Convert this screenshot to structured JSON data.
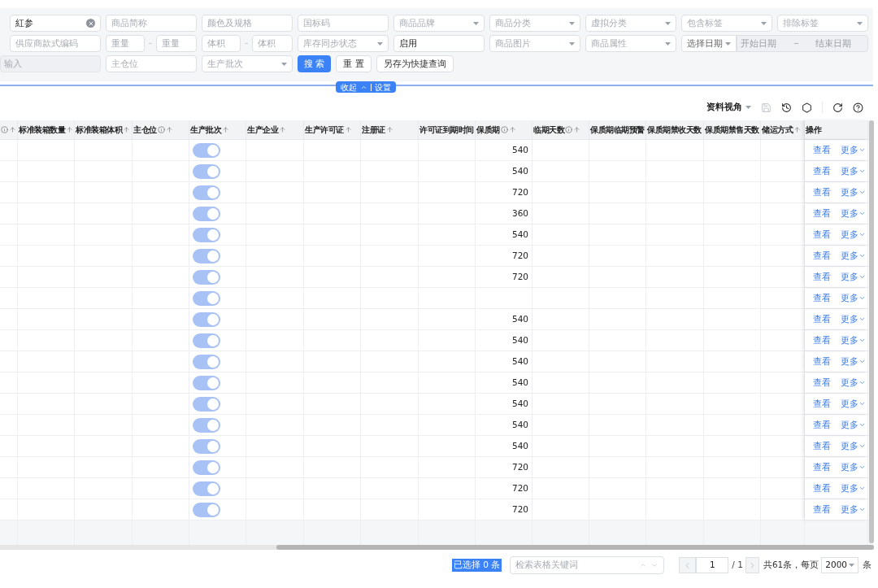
{
  "filters": {
    "rows": [
      {
        "fields": [
          {
            "kind": "input",
            "value": "紅参",
            "clearable": true
          },
          {
            "kind": "input",
            "placeholder": "商品简称"
          },
          {
            "kind": "input",
            "placeholder": "颜色及规格"
          },
          {
            "kind": "input",
            "placeholder": "国标码"
          },
          {
            "kind": "select",
            "placeholder": "商品品牌"
          },
          {
            "kind": "select",
            "placeholder": "商品分类"
          },
          {
            "kind": "select",
            "placeholder": "虚拟分类"
          },
          {
            "kind": "select",
            "placeholder": "包含标签"
          },
          {
            "kind": "select",
            "placeholder": "排除标签"
          }
        ]
      },
      {
        "fields": [
          {
            "kind": "input",
            "placeholder": "供应商款式编码"
          },
          {
            "kind": "range",
            "from": "重量",
            "to": "重量"
          },
          {
            "kind": "range",
            "from": "体积",
            "to": "体积"
          },
          {
            "kind": "select",
            "placeholder": "库存同步状态"
          },
          {
            "kind": "select",
            "value": "启用"
          },
          {
            "kind": "select",
            "placeholder": "商品图片"
          },
          {
            "kind": "select",
            "placeholder": "商品属性"
          },
          {
            "kind": "date_range",
            "mode": "选择日期",
            "start": "开始日期",
            "end": "结束日期"
          }
        ]
      },
      {
        "fields": [
          {
            "kind": "input",
            "placeholder": "输入",
            "disabled": true
          },
          {
            "kind": "input",
            "placeholder": "主仓位"
          },
          {
            "kind": "select",
            "placeholder": "生产批次"
          },
          {
            "kind": "button",
            "label": "搜 索",
            "primary": true
          },
          {
            "kind": "button",
            "label": "重 置",
            "primary": false
          },
          {
            "kind": "button",
            "label": "另存为快捷查询",
            "primary": false
          }
        ]
      }
    ]
  },
  "collapse_tab": {
    "collapse": "收起",
    "settings": "设置"
  },
  "toolbar": {
    "view": "资料视角"
  },
  "table": {
    "columns": [
      {
        "info": true,
        "sortable": true
      },
      {
        "label": "标准装箱数量",
        "info": false,
        "sortable": true
      },
      {
        "label": "标准装箱体积",
        "info": false,
        "sortable": true
      },
      {
        "label": "主仓位",
        "info": true,
        "sortable": true
      },
      {
        "label": "生产批次",
        "info": false,
        "sortable": true
      },
      {
        "label": "生产企业",
        "info": false,
        "sortable": true
      },
      {
        "label": "生产许可证",
        "info": false,
        "sortable": true
      },
      {
        "label": "注册证",
        "info": false,
        "sortable": true
      },
      {
        "label": "许可证到期时间",
        "info": false
      },
      {
        "label": "保质期",
        "info": true,
        "sortable": true
      },
      {
        "label": "临期天数",
        "info": true,
        "sortable": true
      },
      {
        "label": "保质期临期预警",
        "info": false
      },
      {
        "label": "保质期禁收天数",
        "info": false
      },
      {
        "label": "保质期禁售天数",
        "info": false
      },
      {
        "label": "储运方式",
        "info": false,
        "sortable": true
      },
      {
        "label": "操作",
        "info": false
      }
    ],
    "rows": [
      {
        "batch_on": true,
        "shelf_life": "540",
        "view": "查看",
        "more": "更多"
      },
      {
        "batch_on": true,
        "shelf_life": "540",
        "view": "查看",
        "more": "更多"
      },
      {
        "batch_on": true,
        "shelf_life": "720",
        "view": "查看",
        "more": "更多"
      },
      {
        "batch_on": true,
        "shelf_life": "360",
        "view": "查看",
        "more": "更多"
      },
      {
        "batch_on": true,
        "shelf_life": "540",
        "view": "查看",
        "more": "更多"
      },
      {
        "batch_on": true,
        "shelf_life": "720",
        "view": "查看",
        "more": "更多"
      },
      {
        "batch_on": true,
        "shelf_life": "720",
        "view": "查看",
        "more": "更多"
      },
      {
        "batch_on": true,
        "view": "查看",
        "more": "更多"
      },
      {
        "batch_on": true,
        "shelf_life": "540",
        "view": "查看",
        "more": "更多"
      },
      {
        "batch_on": true,
        "shelf_life": "540",
        "view": "查看",
        "more": "更多"
      },
      {
        "batch_on": true,
        "shelf_life": "540",
        "view": "查看",
        "more": "更多"
      },
      {
        "batch_on": true,
        "shelf_life": "540",
        "view": "查看",
        "more": "更多"
      },
      {
        "batch_on": true,
        "shelf_life": "540",
        "view": "查看",
        "more": "更多"
      },
      {
        "batch_on": true,
        "shelf_life": "540",
        "view": "查看",
        "more": "更多"
      },
      {
        "batch_on": true,
        "shelf_life": "540",
        "view": "查看",
        "more": "更多"
      },
      {
        "batch_on": true,
        "shelf_life": "720",
        "view": "查看",
        "more": "更多"
      },
      {
        "batch_on": true,
        "shelf_life": "720",
        "view": "查看",
        "more": "更多"
      },
      {
        "batch_on": true,
        "shelf_life": "720",
        "view": "查看",
        "more": "更多"
      }
    ]
  },
  "footer": {
    "selected": "已选择 0 条",
    "search_placeholder": "检索表格关键词",
    "page": "1",
    "total_pages": "/ 1",
    "summary": "共61条，每页",
    "page_size": "2000",
    "unit": "条"
  }
}
